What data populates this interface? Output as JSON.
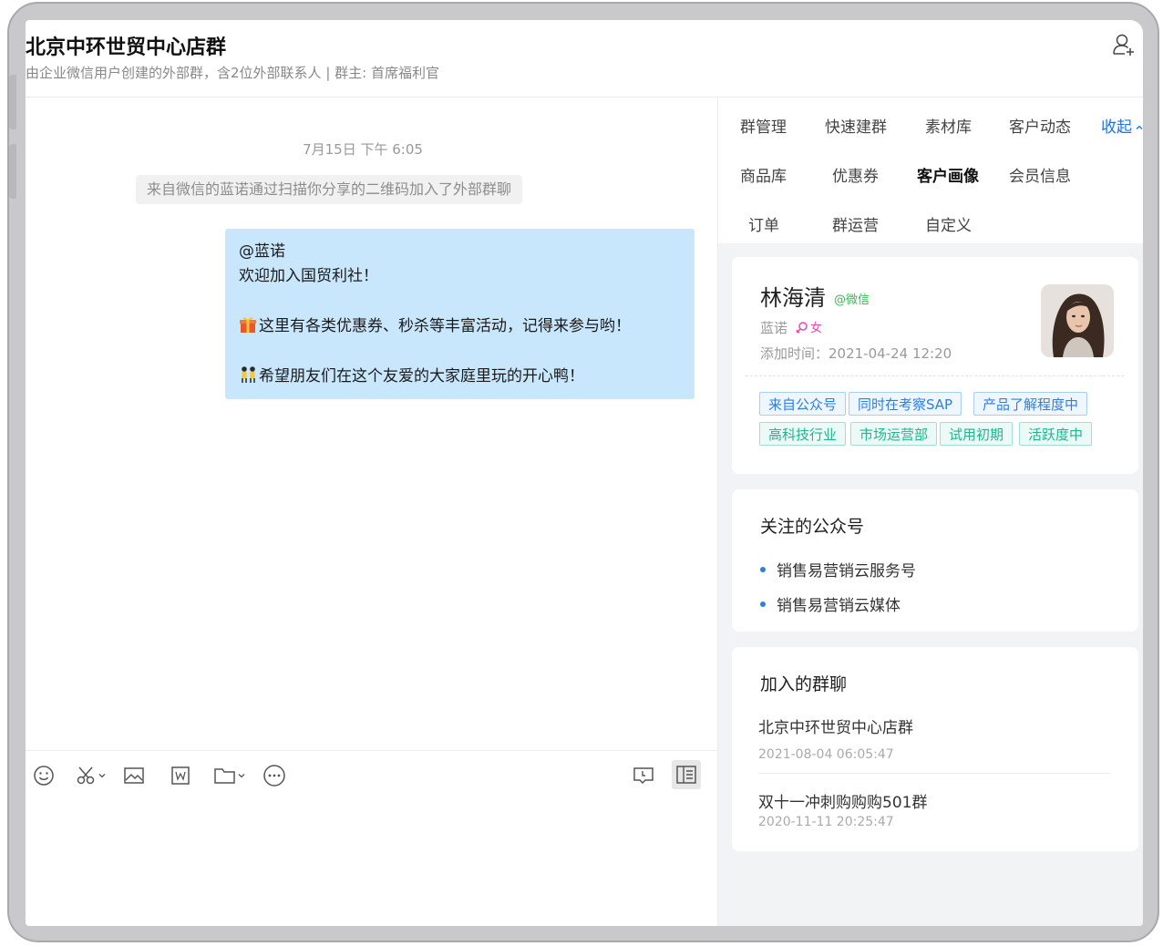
{
  "header": {
    "title": "北京中环世贸中心店群",
    "subtitle": "由企业微信用户创建的外部群，含2位外部联系人 | 群主: 首席福利官"
  },
  "chat": {
    "timestamp": "7月15日 下午 6:05",
    "system_message": "来自微信的蓝诺通过扫描你分享的二维码加入了外部群聊",
    "message": {
      "mention": "@蓝诺",
      "line1": "欢迎加入国贸利社！",
      "line2": "这里有各类优惠券、秒杀等丰富活动，记得来参与哟！",
      "line3": "希望朋友们在这个友爱的大家庭里玩的开心鸭！",
      "line2_emoji": "gift-emoji",
      "line3_emoji": "dancers-emoji"
    },
    "toolbar": [
      "emoji-icon",
      "scissors-icon",
      "image-icon",
      "word-doc-icon",
      "folder-icon",
      "more-icon",
      "chat-record-icon",
      "side-panel-icon"
    ]
  },
  "panel": {
    "tabs": [
      "群管理",
      "快速建群",
      "素材库",
      "客户动态",
      "商品库",
      "优惠券",
      "客户画像",
      "会员信息",
      "订单",
      "群运营",
      "自定义"
    ],
    "active_tab": "客户画像",
    "collapse_label": "收起",
    "customer": {
      "name": "林海清",
      "source_tag": "@微信",
      "nickname": "蓝诺",
      "gender": "女",
      "added_time": "添加时间：2021-04-24 12:20",
      "tags": [
        {
          "label": "来自公众号",
          "color": "blue"
        },
        {
          "label": "同时在考察SAP",
          "color": "blue"
        },
        {
          "label": "产品了解程度中",
          "color": "blue"
        },
        {
          "label": "高科技行业",
          "color": "green"
        },
        {
          "label": "市场运营部",
          "color": "green"
        },
        {
          "label": "试用初期",
          "color": "green"
        },
        {
          "label": "活跃度中",
          "color": "green"
        }
      ]
    },
    "followed": {
      "title": "关注的公众号",
      "accounts": [
        "销售易营销云服务号",
        "销售易营销云媒体"
      ]
    },
    "groups": {
      "title": "加入的群聊",
      "items": [
        {
          "name": "北京中环世贸中心店群",
          "time": "2021-08-04 06:05:47"
        },
        {
          "name": "双十一冲刺购购购501群",
          "time": "2020-11-11 20:25:47"
        }
      ]
    }
  },
  "colors": {
    "accent": "#1a73e8",
    "bubble": "#c8e6fc",
    "tag_blue": "#2f7fe0",
    "tag_green": "#22b38f",
    "wechat_green": "#3cb95a"
  }
}
